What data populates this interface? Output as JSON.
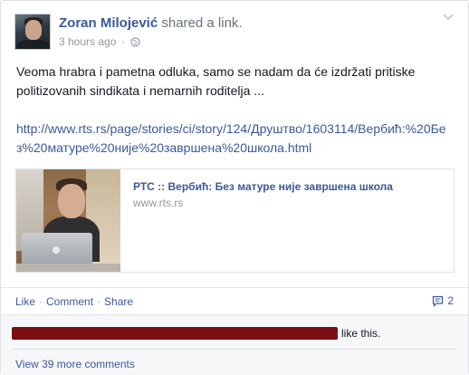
{
  "post": {
    "author": "Zoran Milojević",
    "action": " shared a link.",
    "timestamp": "3 hours ago",
    "body": "Veoma hrabra i pametna odluka, samo se nadam da će izdržati pritiske politizovanih sindikata i nemarnih roditelja ...",
    "link": "http://www.rts.rs/page/stories/ci/story/124/Друштво/1603114/Вербић:%20Без%20матуре%20није%20завршена%20школа.html"
  },
  "preview": {
    "title": "РТС :: Вербић: Без матуре није завршена школа",
    "domain": "www.rts.rs"
  },
  "actions": {
    "like": "Like",
    "comment": "Comment",
    "share": "Share",
    "sep": "·",
    "comments_count": "2"
  },
  "feedback": {
    "likes_suffix": "like this.",
    "view_more": "View 39 more comments"
  },
  "icons": {
    "globe": "globe-icon",
    "chevron": "chevron-down-icon",
    "comment": "comment-icon"
  },
  "colors": {
    "link": "#3b5998",
    "redaction": "#7a0f14"
  }
}
